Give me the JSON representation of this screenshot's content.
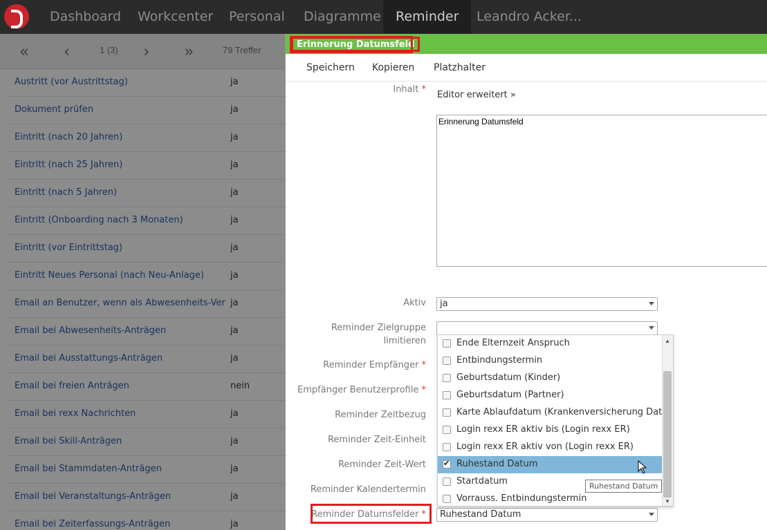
{
  "nav": {
    "items": [
      {
        "label": "Dashboard"
      },
      {
        "label": "Workcenter"
      },
      {
        "label": "Personal"
      },
      {
        "label": "Diagramme"
      },
      {
        "label": "Reminder"
      },
      {
        "label": "Leandro Acker..."
      }
    ],
    "active": "Reminder"
  },
  "pager": {
    "page": "1 (3)",
    "hits": "79 Treffer"
  },
  "list": {
    "rows": [
      {
        "name": "Austritt (vor Austrittstag)",
        "value": "ja"
      },
      {
        "name": "Dokument prüfen",
        "value": "ja"
      },
      {
        "name": "Eintritt (nach 20 Jahren)",
        "value": "ja"
      },
      {
        "name": "Eintritt (nach 25 Jahren)",
        "value": "ja"
      },
      {
        "name": "Eintritt (nach 5 Jahren)",
        "value": "ja"
      },
      {
        "name": "Eintritt (Onboarding nach 3 Monaten)",
        "value": "ja"
      },
      {
        "name": "Eintritt (vor Eintrittstag)",
        "value": "ja"
      },
      {
        "name": "Eintritt Neues Personal (nach Neu-Anlage)",
        "value": "ja"
      },
      {
        "name": "Email an Benutzer, wenn als Abwesenheits-Vertre",
        "value": "ja"
      },
      {
        "name": "Email bei Abwesenheits-Anträgen",
        "value": "ja"
      },
      {
        "name": "Email bei Ausstattungs-Anträgen",
        "value": "ja"
      },
      {
        "name": "Email bei freien Anträgen",
        "value": "nein"
      },
      {
        "name": "Email bei rexx Nachrichten",
        "value": "ja"
      },
      {
        "name": "Email bei Skill-Anträgen",
        "value": "ja"
      },
      {
        "name": "Email bei Stammdaten-Anträgen",
        "value": "ja"
      },
      {
        "name": "Email bei Veranstaltungs-Anträgen",
        "value": "ja"
      },
      {
        "name": "Email bei Zeiterfassungs-Anträgen",
        "value": "ja"
      }
    ]
  },
  "dialog": {
    "title": "Erinnerung Datumsfeld",
    "toolbar": {
      "save": "Speichern",
      "copy": "Kopieren",
      "placeholder": "Platzhalter"
    },
    "fields": {
      "content_label": "Inhalt",
      "editor_link": "Editor erweitert",
      "content_value": "Erinnerung Datumsfeld",
      "active_label": "Aktiv",
      "active_value": "ja",
      "target_group_label": "Reminder Zielgruppe limitieren",
      "target_group_value": "",
      "recipient_label": "Reminder Empfänger",
      "recipient_profiles_label": "Empfänger Benutzerprofile",
      "time_ref_label": "Reminder Zeitbezug",
      "time_unit_label": "Reminder Zeit-Einheit",
      "time_value_label": "Reminder Zeit-Wert",
      "calendar_label": "Reminder Kalendertermin",
      "date_fields_label": "Reminder Datumsfelder",
      "date_fields_value": "Ruhestand Datum",
      "required_mark": "*"
    },
    "dropdown": {
      "options": [
        {
          "label": "Ende Elternzeit Anspruch",
          "checked": false
        },
        {
          "label": "Entbindungstermin",
          "checked": false
        },
        {
          "label": "Geburtsdatum (Kinder)",
          "checked": false
        },
        {
          "label": "Geburtsdatum (Partner)",
          "checked": false
        },
        {
          "label": "Karte Ablaufdatum (Krankenversicherung Daten)",
          "checked": false
        },
        {
          "label": "Login rexx ER aktiv bis (Login rexx ER)",
          "checked": false
        },
        {
          "label": "Login rexx ER aktiv von (Login rexx ER)",
          "checked": false
        },
        {
          "label": "Ruhestand Datum",
          "checked": true
        },
        {
          "label": "Startdatum",
          "checked": false
        },
        {
          "label": "Vorrauss. Entbindungstermin",
          "checked": false
        }
      ],
      "tooltip": "Ruhestand Datum"
    }
  },
  "icons": {
    "first": "double-chevron-left-icon",
    "prev": "chevron-left-icon",
    "next": "chevron-right-icon",
    "last": "double-chevron-right-icon",
    "logo": "rexx-logo"
  },
  "colors": {
    "nav_bg": "#2b2b2b",
    "dialog_header": "#6abf45",
    "highlight": "#e01e1e",
    "selected_option": "#7fb6d9",
    "link": "#2b5ea8"
  }
}
